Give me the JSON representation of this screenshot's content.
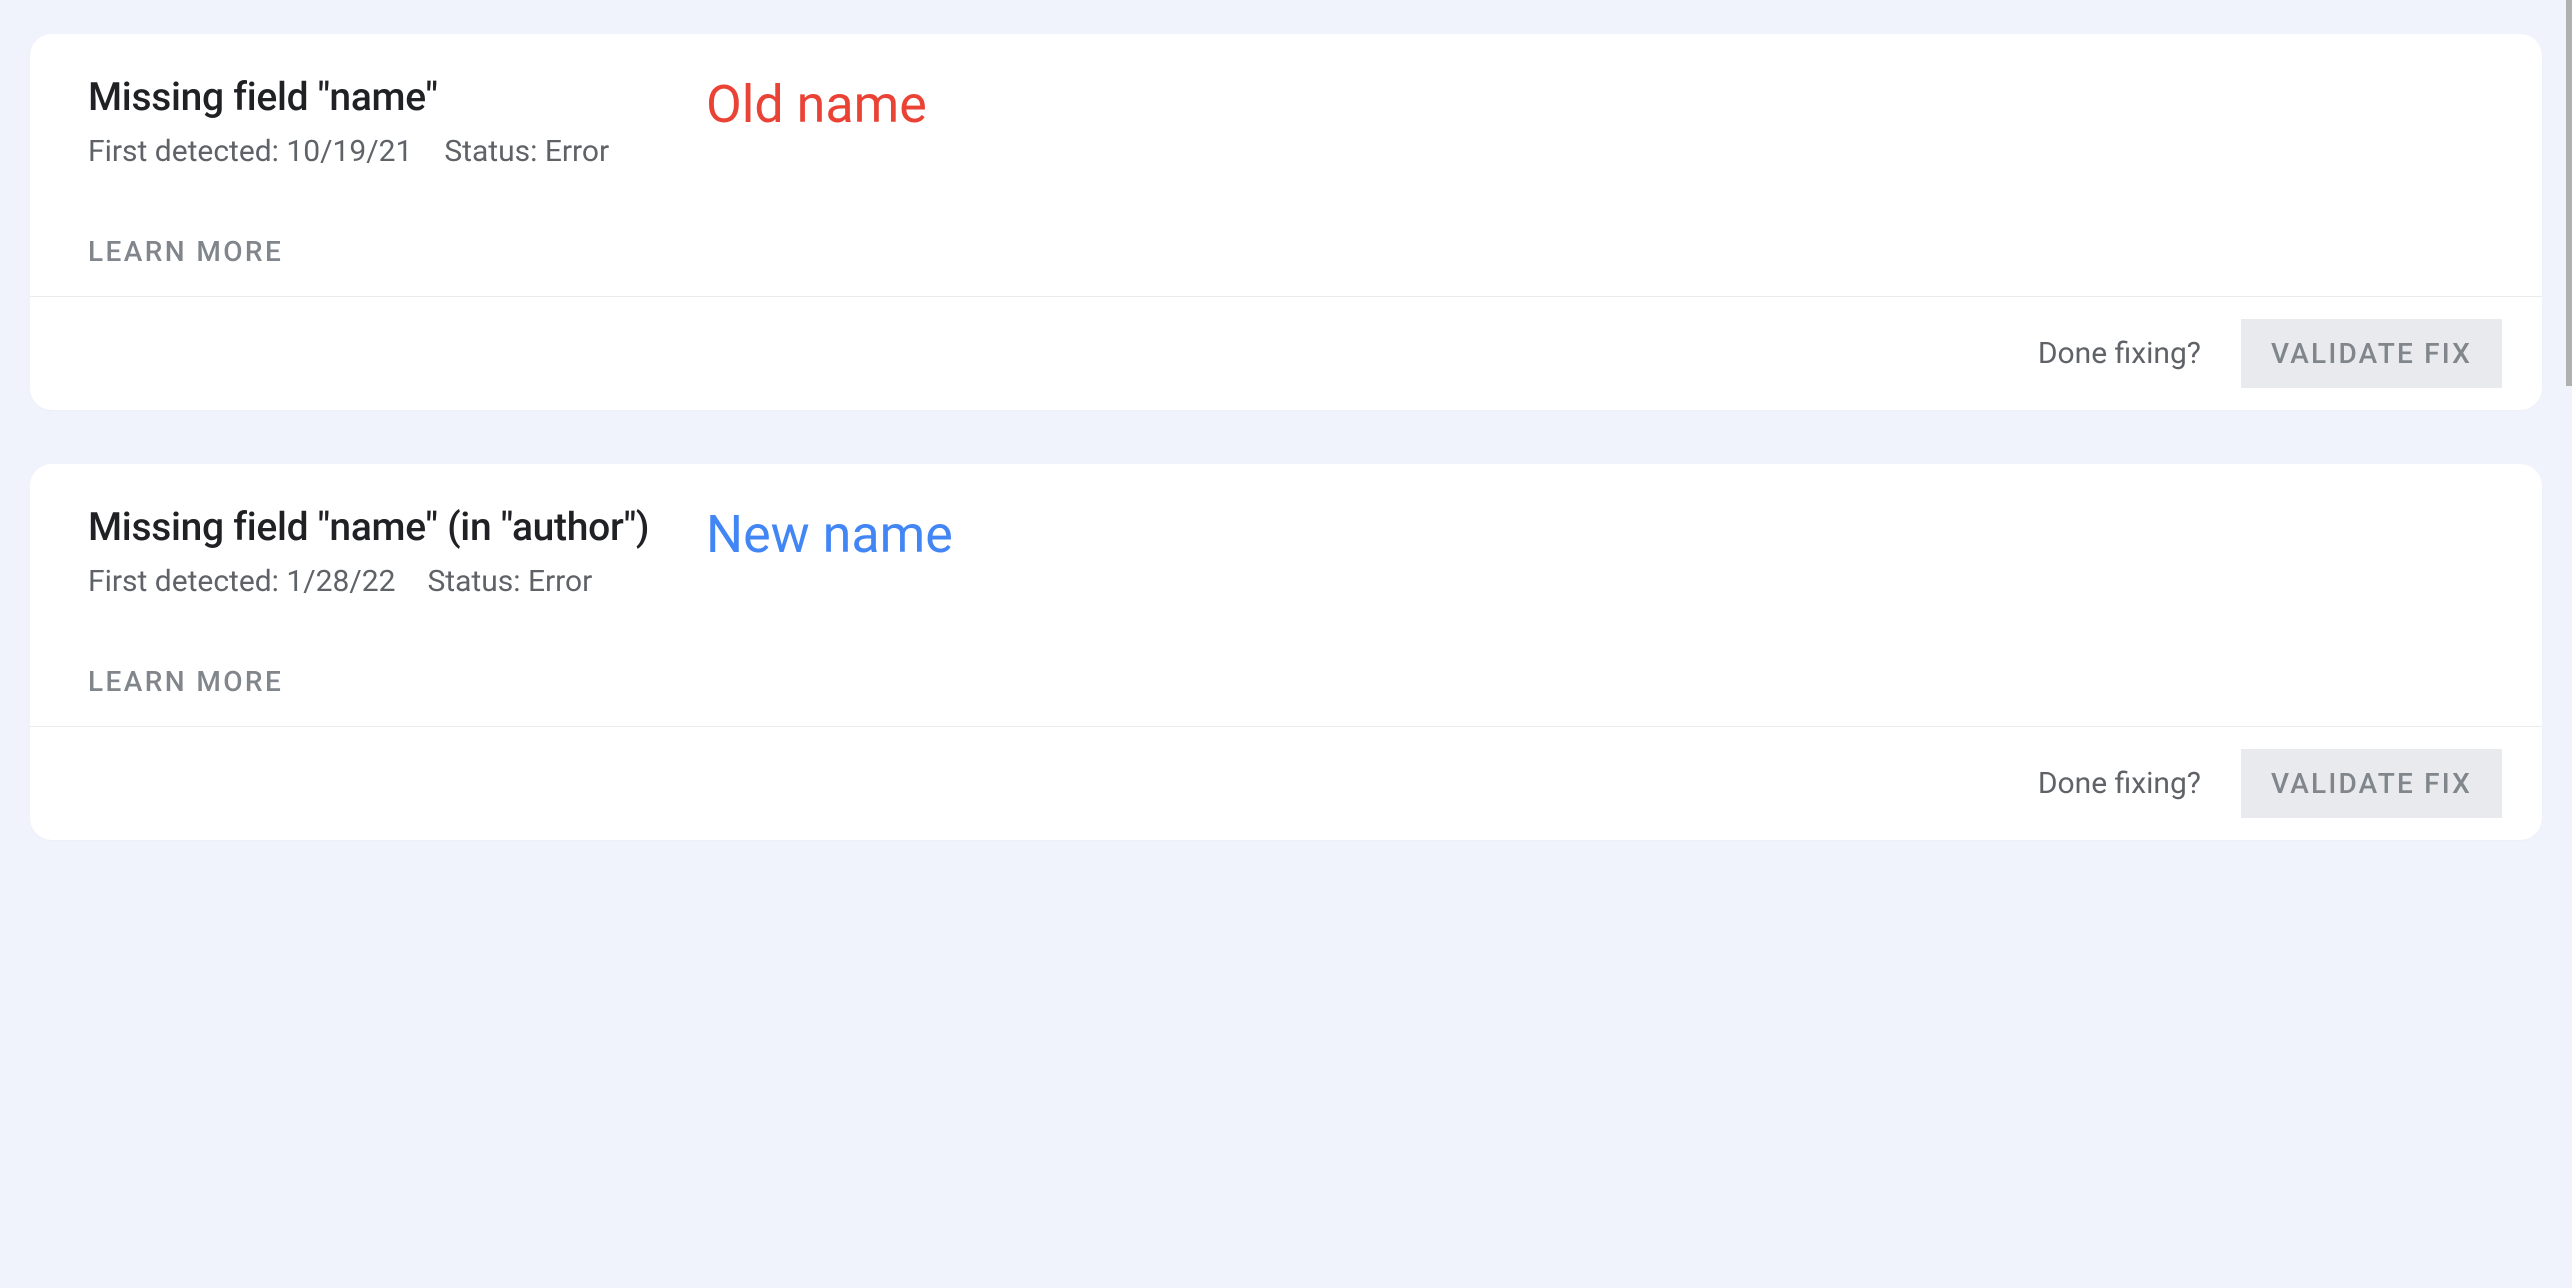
{
  "cards": [
    {
      "title": "Missing field \"name\"",
      "detected_label": "First detected:",
      "detected_value": "10/19/21",
      "status_label": "Status:",
      "status_value": "Error",
      "learn_more": "LEARN MORE",
      "done_fixing": "Done fixing?",
      "validate": "VALIDATE FIX",
      "annotation": "Old name",
      "annotation_class": "annotation-old"
    },
    {
      "title": "Missing field \"name\" (in \"author\")",
      "detected_label": "First detected:",
      "detected_value": "1/28/22",
      "status_label": "Status:",
      "status_value": "Error",
      "learn_more": "LEARN MORE",
      "done_fixing": "Done fixing?",
      "validate": "VALIDATE FIX",
      "annotation": "New name",
      "annotation_class": "annotation-new"
    }
  ]
}
